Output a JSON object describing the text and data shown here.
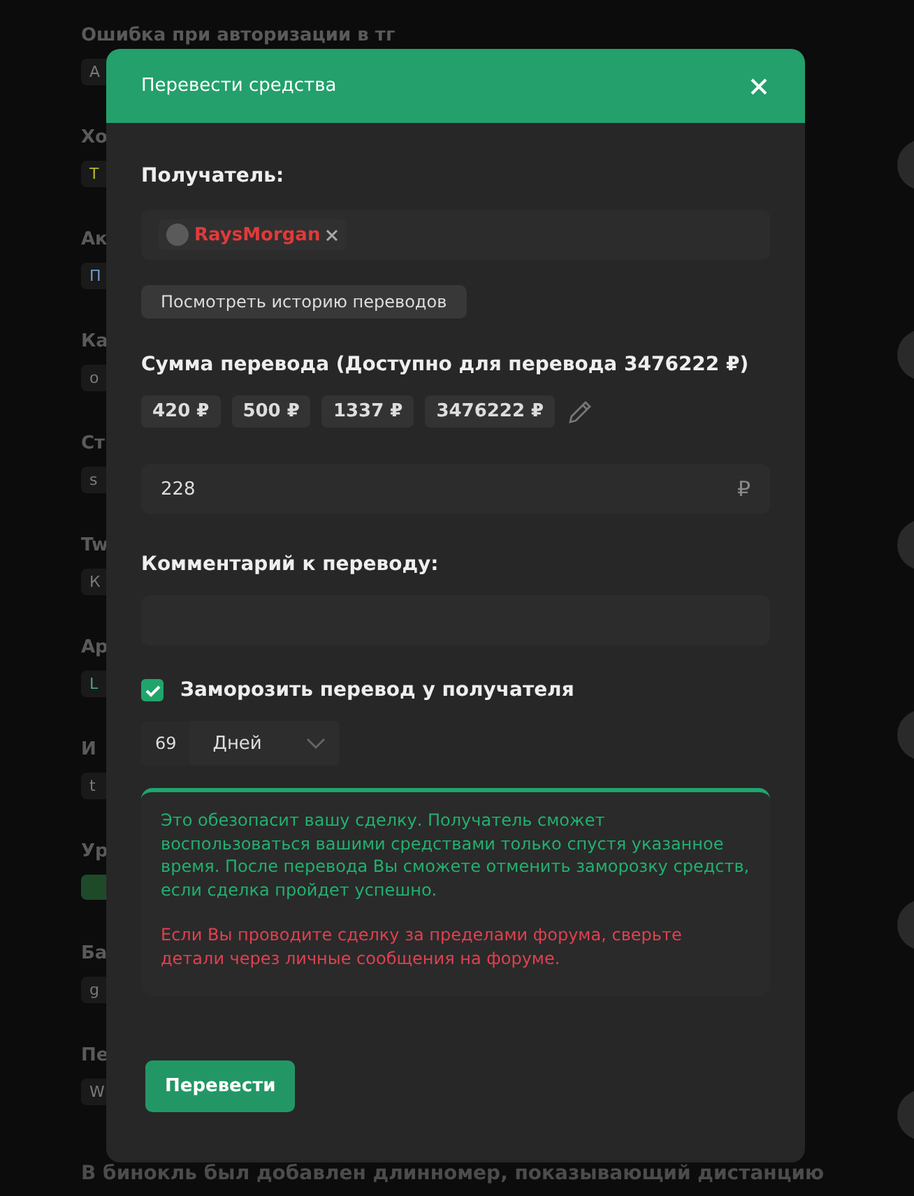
{
  "background": {
    "topics": [
      {
        "title": "Ошибка при авторизации в тг",
        "tag": "A",
        "color": "#7a7a7a"
      },
      {
        "title": "Хо",
        "tag": "T",
        "color": "#b8b82a"
      },
      {
        "title": "Ак",
        "tag": "П",
        "color": "#6f9ccc"
      },
      {
        "title": "Ка",
        "tag": "o",
        "color": "#7a7a7a"
      },
      {
        "title": "Ст",
        "tag": "s",
        "color": "#7a7a7a"
      },
      {
        "title": "Tw",
        "tag": "К",
        "color": "#7a7a7a"
      },
      {
        "title": "Ар",
        "tag": "L",
        "color": "#4fa07e"
      },
      {
        "title": "И",
        "tag": "t",
        "color": "#7a7a7a"
      },
      {
        "title": "Ур",
        "color": "#1f4a2a"
      },
      {
        "title": "Ба",
        "tag": "g",
        "color": "#7a7a7a"
      },
      {
        "title": "Пе",
        "tag": "W",
        "color": "#7a7a7a"
      }
    ],
    "footer_text": "В бинокль был добавлен длинномер, показывающий дистанцию"
  },
  "dialog": {
    "title": "Перевести средства",
    "recipient": {
      "label": "Получатель:",
      "name": "RaysMorgan"
    },
    "history_button": "Посмотреть историю переводов",
    "amount": {
      "label": "Сумма перевода (Доступно для перевода 3476222 ₽)",
      "presets": [
        "420 ₽",
        "500 ₽",
        "1337 ₽",
        "3476222 ₽"
      ],
      "value": "228",
      "currency": "₽"
    },
    "comment": {
      "label": "Комментарий к переводу:"
    },
    "freeze": {
      "label": "Заморозить перевод у получателя",
      "checked": true,
      "count": "69",
      "unit": "Дней"
    },
    "notice": {
      "info": "Это обезопасит вашу сделку. Получатель сможет воспользоваться вашими средствами только спустя указанное время. После перевода Вы сможете отменить заморозку средств, если сделка пройдет успешно.",
      "warning": "Если Вы проводите сделку за пределами форума, сверьте детали через личные сообщения на форуме."
    },
    "submit": "Перевести"
  }
}
